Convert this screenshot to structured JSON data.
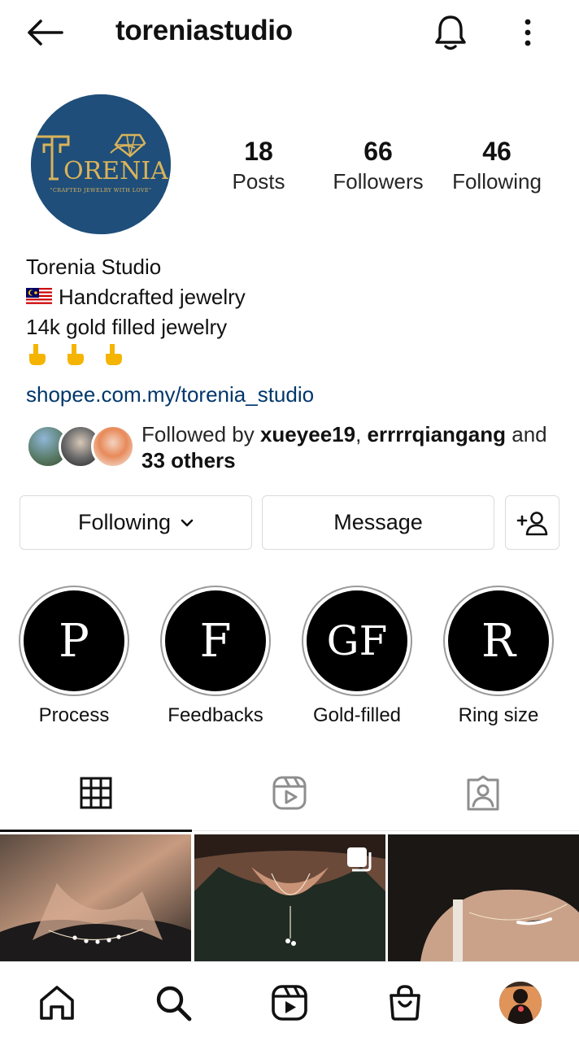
{
  "header": {
    "username": "toreniastudio",
    "back_icon": "arrow-left-icon",
    "bell_icon": "bell-icon",
    "more_icon": "more-vertical-icon"
  },
  "avatar": {
    "logo_text": "ORENIA",
    "logo_tagline": "CRAFTED JEWELRY WITH LOVE",
    "bg_color": "#1f4e7a",
    "accent_color": "#d9b35a"
  },
  "stats": {
    "posts": {
      "value": "18",
      "label": "Posts"
    },
    "followers": {
      "value": "66",
      "label": "Followers"
    },
    "following": {
      "value": "46",
      "label": "Following"
    }
  },
  "bio": {
    "name": "Torenia Studio",
    "line1": "Handcrafted jewelry",
    "line2": "14k gold filled jewelry",
    "pointers": "👇 👇 👇",
    "link": "shopee.com.my/torenia_studio",
    "link_color": "#00376b"
  },
  "followed_by": {
    "prefix": "Followed by ",
    "user1": "xueyee19",
    "sep": ", ",
    "user2": "errrrqiangang",
    "suffix": " and",
    "others": "33 others"
  },
  "actions": {
    "following_label": "Following",
    "message_label": "Message",
    "add_user_icon": "add-person-icon"
  },
  "highlights": [
    {
      "letter": "P",
      "label": "Process"
    },
    {
      "letter": "F",
      "label": "Feedbacks"
    },
    {
      "letter": "GF",
      "label": "Gold-filled"
    },
    {
      "letter": "R",
      "label": "Ring size"
    }
  ],
  "tabs": [
    {
      "icon": "grid-icon",
      "active": true
    },
    {
      "icon": "reels-icon",
      "active": false
    },
    {
      "icon": "tagged-icon",
      "active": false
    }
  ],
  "bottom_nav": [
    {
      "icon": "home-icon"
    },
    {
      "icon": "search-icon"
    },
    {
      "icon": "reels-icon"
    },
    {
      "icon": "shop-icon"
    },
    {
      "icon": "profile-avatar"
    }
  ]
}
